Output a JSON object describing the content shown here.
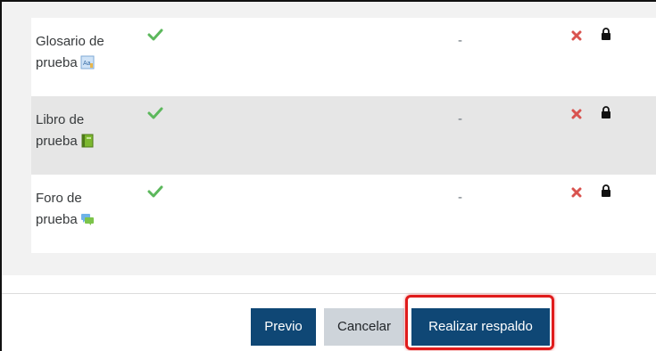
{
  "activities": [
    {
      "name_line1": "Glosario de",
      "name_line2": "prueba",
      "icon": "glossary-icon",
      "included": "checkmark-icon",
      "user_data": "-",
      "exclude": "cross-icon",
      "locked": "lock-icon"
    },
    {
      "name_line1": "Libro de",
      "name_line2": "prueba",
      "icon": "book-icon",
      "included": "checkmark-icon",
      "user_data": "-",
      "exclude": "cross-icon",
      "locked": "lock-icon"
    },
    {
      "name_line1": "Foro de",
      "name_line2": "prueba",
      "icon": "forum-icon",
      "included": "checkmark-icon",
      "user_data": "-",
      "exclude": "cross-icon",
      "locked": "lock-icon"
    }
  ],
  "buttons": {
    "previous": "Previo",
    "cancel": "Cancelar",
    "perform_backup": "Realizar respaldo"
  },
  "colors": {
    "primary": "#0f4775",
    "secondary": "#ced4da",
    "check": "#5cb85c",
    "cross": "#d9534f",
    "highlight": "#e01b1b"
  }
}
